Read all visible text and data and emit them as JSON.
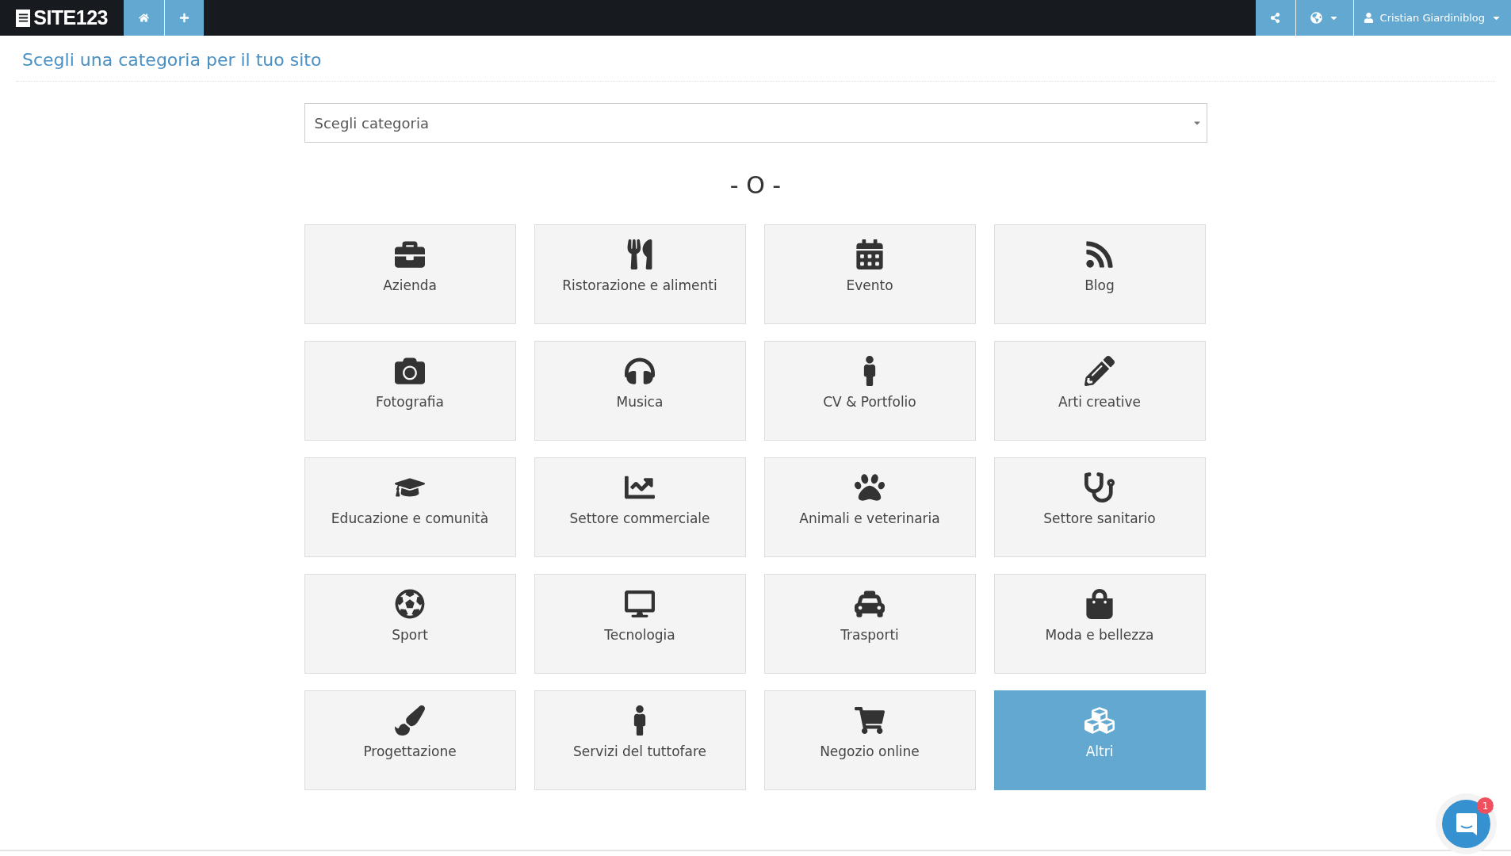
{
  "topbar": {
    "logo": "SITE123",
    "user": "Cristian Giardiniblog"
  },
  "page_title": "Scegli una categoria per il tuo sito",
  "category_select": {
    "placeholder": "Scegli categoria"
  },
  "separator": "- O -",
  "categories": [
    {
      "label": "Azienda",
      "selected": false
    },
    {
      "label": "Ristorazione e alimenti",
      "selected": false
    },
    {
      "label": "Evento",
      "selected": false
    },
    {
      "label": "Blog",
      "selected": false
    },
    {
      "label": "Fotografia",
      "selected": false
    },
    {
      "label": "Musica",
      "selected": false
    },
    {
      "label": "CV & Portfolio",
      "selected": false
    },
    {
      "label": "Arti creative",
      "selected": false
    },
    {
      "label": "Educazione e comunità",
      "selected": false
    },
    {
      "label": "Settore commerciale",
      "selected": false
    },
    {
      "label": "Animali e veterinaria",
      "selected": false
    },
    {
      "label": "Settore sanitario",
      "selected": false
    },
    {
      "label": "Sport",
      "selected": false
    },
    {
      "label": "Tecnologia",
      "selected": false
    },
    {
      "label": "Trasporti",
      "selected": false
    },
    {
      "label": "Moda e bellezza",
      "selected": false
    },
    {
      "label": "Progettazione",
      "selected": false
    },
    {
      "label": "Servizi del tuttofare",
      "selected": false
    },
    {
      "label": "Negozio online",
      "selected": false
    },
    {
      "label": "Altri",
      "selected": true
    }
  ],
  "chat": {
    "badge": "1"
  }
}
